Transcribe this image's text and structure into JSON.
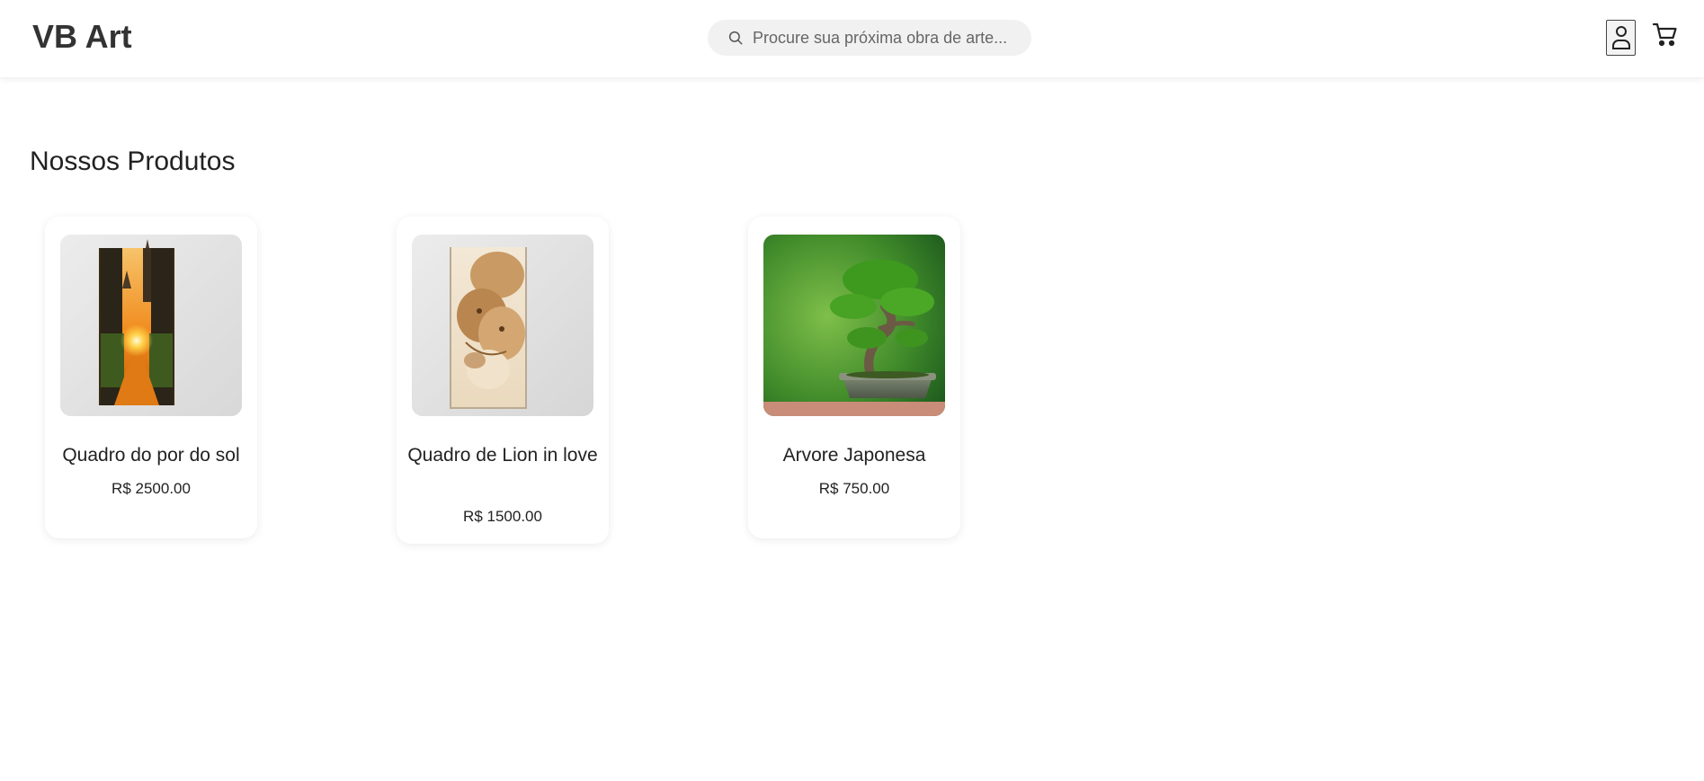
{
  "header": {
    "logo": "VB Art",
    "search_placeholder": "Procure sua próxima obra de arte...",
    "icons": {
      "search": "search-icon",
      "user": "user-icon",
      "cart": "cart-icon"
    }
  },
  "main": {
    "title": "Nossos Produtos",
    "products": [
      {
        "name": "Quadro do por do sol",
        "price": "R$ 2500.00",
        "image": "sunset-city-painting"
      },
      {
        "name": "Quadro de Lion in love",
        "price": "R$ 1500.00",
        "image": "lions-painting"
      },
      {
        "name": "Arvore Japonesa",
        "price": "R$ 750.00",
        "image": "bonsai-tree-photo"
      }
    ]
  }
}
